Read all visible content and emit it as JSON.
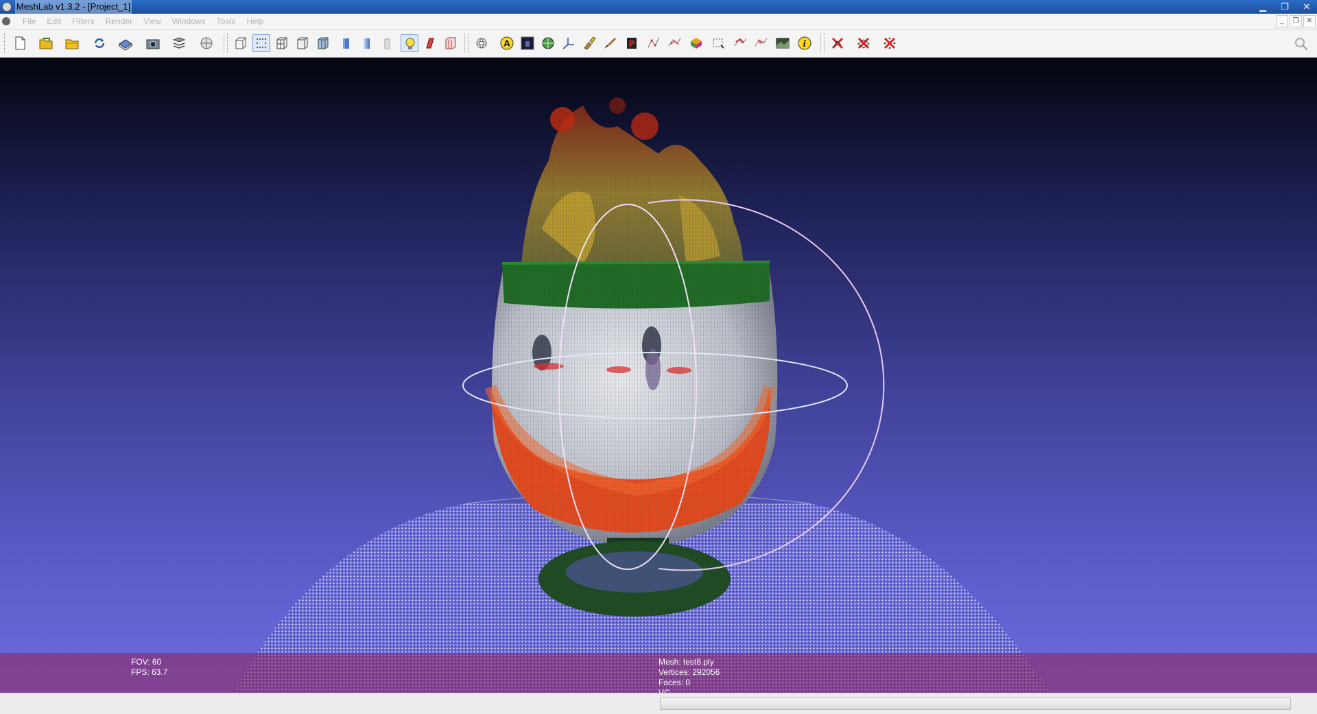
{
  "window": {
    "title": "MeshLab v1.3.2 - [Project_1]",
    "minimize_glyph": "▁",
    "restore_glyph": "❐",
    "close_glyph": "✕"
  },
  "menubar": {
    "items": [
      "File",
      "Edit",
      "Filters",
      "Render",
      "View",
      "Windows",
      "Tools",
      "Help"
    ],
    "mdi_minimize_glyph": "_",
    "mdi_restore_glyph": "❐",
    "mdi_close_glyph": "✕"
  },
  "toolbar": {
    "icons": [
      "new-project-icon",
      "open-project-icon",
      "open-mesh-icon",
      "reload-icon",
      "save-icon",
      "snapshot-icon",
      "layers-icon",
      "raster-icon",
      "bbox-icon",
      "points-icon",
      "wireframe-icon",
      "hidden-lines-icon",
      "flat-lines-icon",
      "flat-icon",
      "smooth-icon",
      "texture-icon",
      "light-icon",
      "double-side-light-icon",
      "fancy-light-icon",
      "trackball-icon",
      "annotation-icon",
      "color-balance-icon",
      "sphere-icon",
      "axis-icon",
      "paint-icon",
      "brush-icon",
      "pick-points-icon",
      "select-vertices-icon",
      "select-connected-icon",
      "select-faces-icon",
      "select-area-icon",
      "cut-icon",
      "edit-faces-icon",
      "raster-align-icon",
      "info-icon",
      "delete-vertices-icon",
      "delete-faces-icon",
      "delete-selection-icon"
    ],
    "active_icon": "light-icon"
  },
  "viewport": {
    "background_top": "#04050e",
    "background_bottom": "#6d6ce0",
    "trackball_color": "#e6ccf0"
  },
  "info": {
    "fov": "FOV: 60",
    "fps": "FPS:   63.7",
    "mesh": "Mesh: test8.ply",
    "vertices": "Vertices: 292056",
    "faces": "Faces: 0",
    "vc": "VC"
  }
}
